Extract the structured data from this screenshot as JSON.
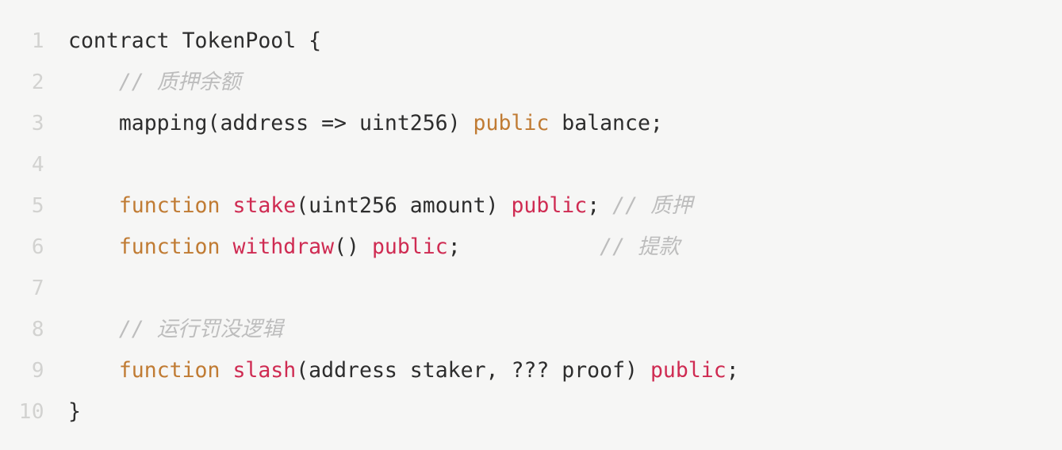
{
  "editor": {
    "title": "solidity-code-snippet",
    "background_color": "#f6f6f5",
    "default_text_color": "#2d2d2d",
    "keyword_color": "#c07b33",
    "identifier_color": "#cf2b52",
    "comment_color": "#bdbdbd",
    "line_number_color": "#d2d2d0"
  },
  "lines": [
    {
      "number": "1",
      "tokens": [
        {
          "text": "contract TokenPool {",
          "type": "plain"
        }
      ]
    },
    {
      "number": "2",
      "tokens": [
        {
          "text": "    ",
          "type": "plain"
        },
        {
          "text": "// 质押余额",
          "type": "comment"
        }
      ]
    },
    {
      "number": "3",
      "tokens": [
        {
          "text": "    mapping(address => uint256) ",
          "type": "plain"
        },
        {
          "text": "public",
          "type": "keyword"
        },
        {
          "text": " balance;",
          "type": "plain"
        }
      ]
    },
    {
      "number": "4",
      "tokens": [
        {
          "text": "",
          "type": "plain"
        }
      ]
    },
    {
      "number": "5",
      "tokens": [
        {
          "text": "    ",
          "type": "plain"
        },
        {
          "text": "function",
          "type": "keyword"
        },
        {
          "text": " ",
          "type": "plain"
        },
        {
          "text": "stake",
          "type": "name"
        },
        {
          "text": "(uint256 amount) ",
          "type": "plain"
        },
        {
          "text": "public",
          "type": "name"
        },
        {
          "text": "; ",
          "type": "plain"
        },
        {
          "text": "// 质押",
          "type": "comment"
        }
      ]
    },
    {
      "number": "6",
      "tokens": [
        {
          "text": "    ",
          "type": "plain"
        },
        {
          "text": "function",
          "type": "keyword"
        },
        {
          "text": " ",
          "type": "plain"
        },
        {
          "text": "withdraw",
          "type": "name"
        },
        {
          "text": "() ",
          "type": "plain"
        },
        {
          "text": "public",
          "type": "name"
        },
        {
          "text": ";           ",
          "type": "plain"
        },
        {
          "text": "// 提款",
          "type": "comment"
        }
      ]
    },
    {
      "number": "7",
      "tokens": [
        {
          "text": "",
          "type": "plain"
        }
      ]
    },
    {
      "number": "8",
      "tokens": [
        {
          "text": "    ",
          "type": "plain"
        },
        {
          "text": "// 运行罚没逻辑",
          "type": "comment"
        }
      ]
    },
    {
      "number": "9",
      "tokens": [
        {
          "text": "    ",
          "type": "plain"
        },
        {
          "text": "function",
          "type": "keyword"
        },
        {
          "text": " ",
          "type": "plain"
        },
        {
          "text": "slash",
          "type": "name"
        },
        {
          "text": "(address staker, ??? proof) ",
          "type": "plain"
        },
        {
          "text": "public",
          "type": "name"
        },
        {
          "text": ";",
          "type": "plain"
        }
      ]
    },
    {
      "number": "10",
      "tokens": [
        {
          "text": "}",
          "type": "plain"
        }
      ]
    }
  ]
}
